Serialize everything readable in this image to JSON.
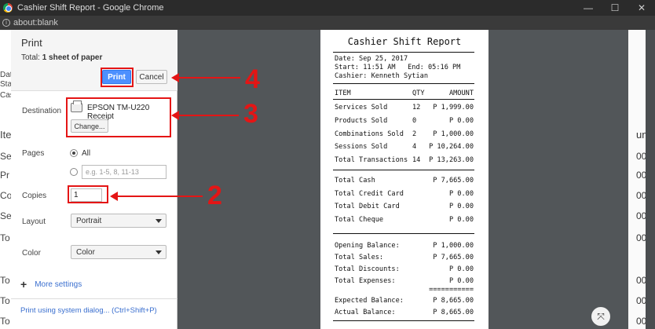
{
  "window": {
    "title": "Cashier Shift Report - Google Chrome",
    "address": "about:blank",
    "minimize": "—",
    "maximize": "☐",
    "close": "✕"
  },
  "background_page": {
    "left_fragments": [
      "Date",
      "Star",
      "Cas",
      "Ite",
      "Se",
      "Pr",
      "Co",
      "Se",
      "To",
      "To",
      "To",
      "To"
    ],
    "right_header": "unt",
    "right_values": [
      "00",
      "00",
      "00",
      "00",
      "00",
      "00",
      "00",
      "00"
    ]
  },
  "print_panel": {
    "title": "Print",
    "total_prefix": "Total: ",
    "total_value": "1 sheet of paper",
    "print_label": "Print",
    "cancel_label": "Cancel",
    "destination_label": "Destination",
    "destination_name": "EPSON TM-U220 Receipt",
    "change_label": "Change...",
    "pages_label": "Pages",
    "pages_all": "All",
    "pages_placeholder": "e.g. 1-5, 8, 11-13",
    "copies_label": "Copies",
    "copies_value": "1",
    "layout_label": "Layout",
    "layout_value": "Portrait",
    "color_label": "Color",
    "color_value": "Color",
    "more_settings": "More settings",
    "system_dialog": "Print using system dialog... (Ctrl+Shift+P)"
  },
  "receipt": {
    "title": "Cashier Shift Report",
    "date": "Date: Sep 25, 2017",
    "start_end": "Start: 11:51 AM   End: 05:16 PM",
    "cashier": "Cashier: Kenneth Sytian",
    "headers": {
      "item": "ITEM",
      "qty": "QTY",
      "amount": "AMOUNT"
    },
    "items": [
      {
        "name": "Services Sold",
        "qty": "12",
        "amount": "P 1,999.00"
      },
      {
        "name": "Products Sold",
        "qty": "0",
        "amount": "P 0.00"
      },
      {
        "name": "Combinations Sold",
        "qty": "2",
        "amount": "P 1,000.00"
      },
      {
        "name": "Sessions Sold",
        "qty": "4",
        "amount": "P 10,264.00"
      },
      {
        "name": "Total Transactions",
        "qty": "14",
        "amount": "P 13,263.00"
      }
    ],
    "payments": [
      {
        "name": "Total Cash",
        "amount": "P 7,665.00"
      },
      {
        "name": "Total Credit Card",
        "amount": "P 0.00"
      },
      {
        "name": "Total Debit Card",
        "amount": "P 0.00"
      },
      {
        "name": "Total Cheque",
        "amount": "P 0.00"
      }
    ],
    "balances": [
      {
        "name": "Opening Balance:",
        "amount": "P 1,000.00"
      },
      {
        "name": "Total Sales:",
        "amount": "P 7,665.00"
      },
      {
        "name": "Total Discounts:",
        "amount": "P 0.00"
      },
      {
        "name": "Total Expenses:",
        "amount": "P 0.00"
      }
    ],
    "double_line": "===========",
    "final": [
      {
        "name": "Expected Balance:",
        "amount": "P 8,665.00"
      },
      {
        "name": "Actual Balance:",
        "amount": "P 8,665.00"
      }
    ]
  },
  "annotations": {
    "n4": "4",
    "n3": "3",
    "n2": "2"
  },
  "colors": {
    "annotation": "#e41515",
    "print_button": "#4d90fe",
    "link": "#3a6fcf"
  },
  "icons": {
    "zoom": "fit-to-page-icon",
    "printer": "printer-icon",
    "plus": "plus-icon"
  }
}
